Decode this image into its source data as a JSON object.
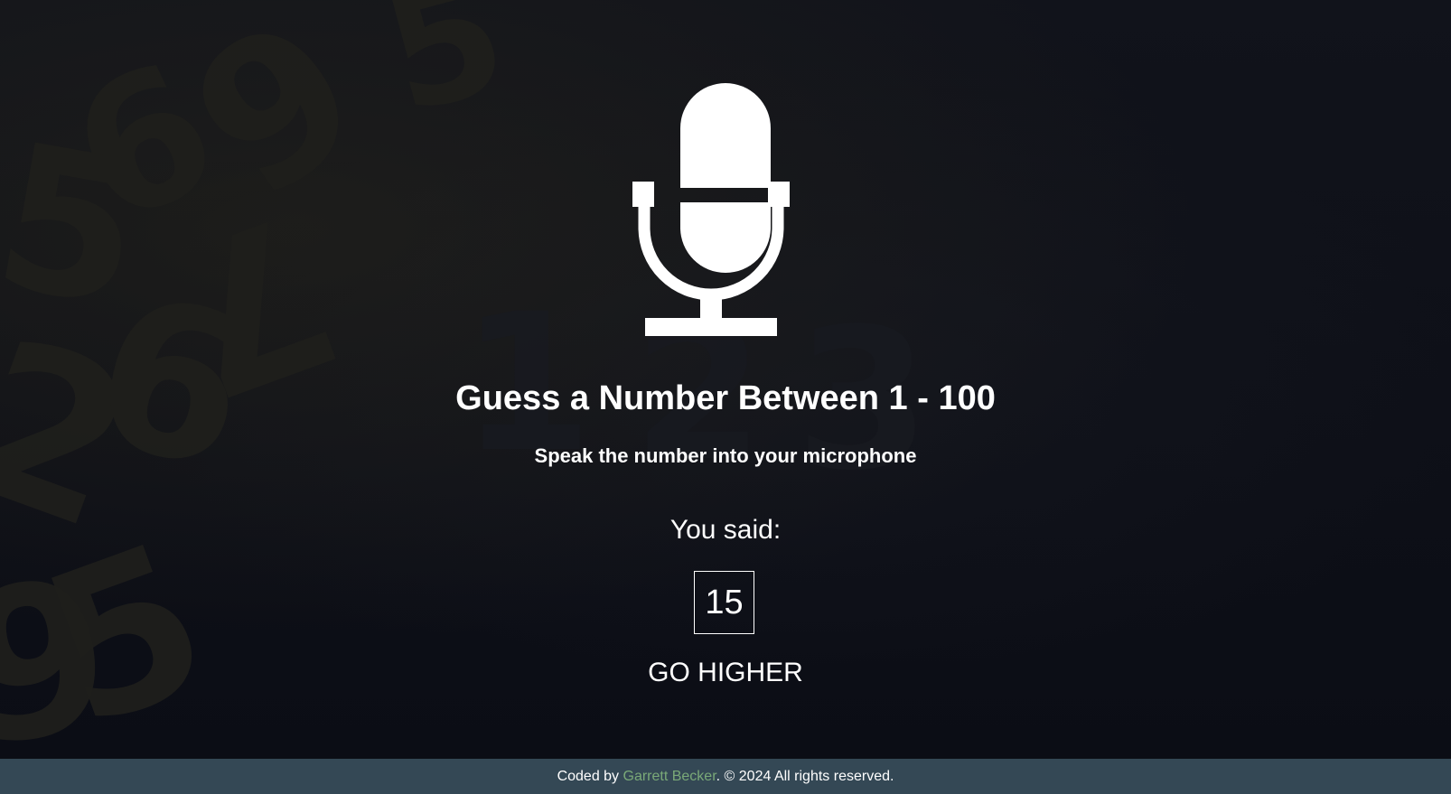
{
  "background": {
    "digits": [
      "5",
      "9",
      "6",
      "5",
      "1",
      "2",
      "3",
      "2",
      "6",
      "5",
      "7",
      "9"
    ]
  },
  "main": {
    "mic_icon": "microphone-icon",
    "title": "Guess a Number Between 1 - 100",
    "subtitle": "Speak the number into your microphone",
    "you_said_label": "You said:",
    "guess_value": "15",
    "hint": "GO HIGHER"
  },
  "footer": {
    "prefix": "Coded by ",
    "author": "Garrett Becker",
    "suffix": ". © 2024 All rights reserved."
  },
  "colors": {
    "background": "#0f1119",
    "footer_bg": "#344855",
    "author_link": "#7aa978",
    "text": "#ffffff"
  }
}
